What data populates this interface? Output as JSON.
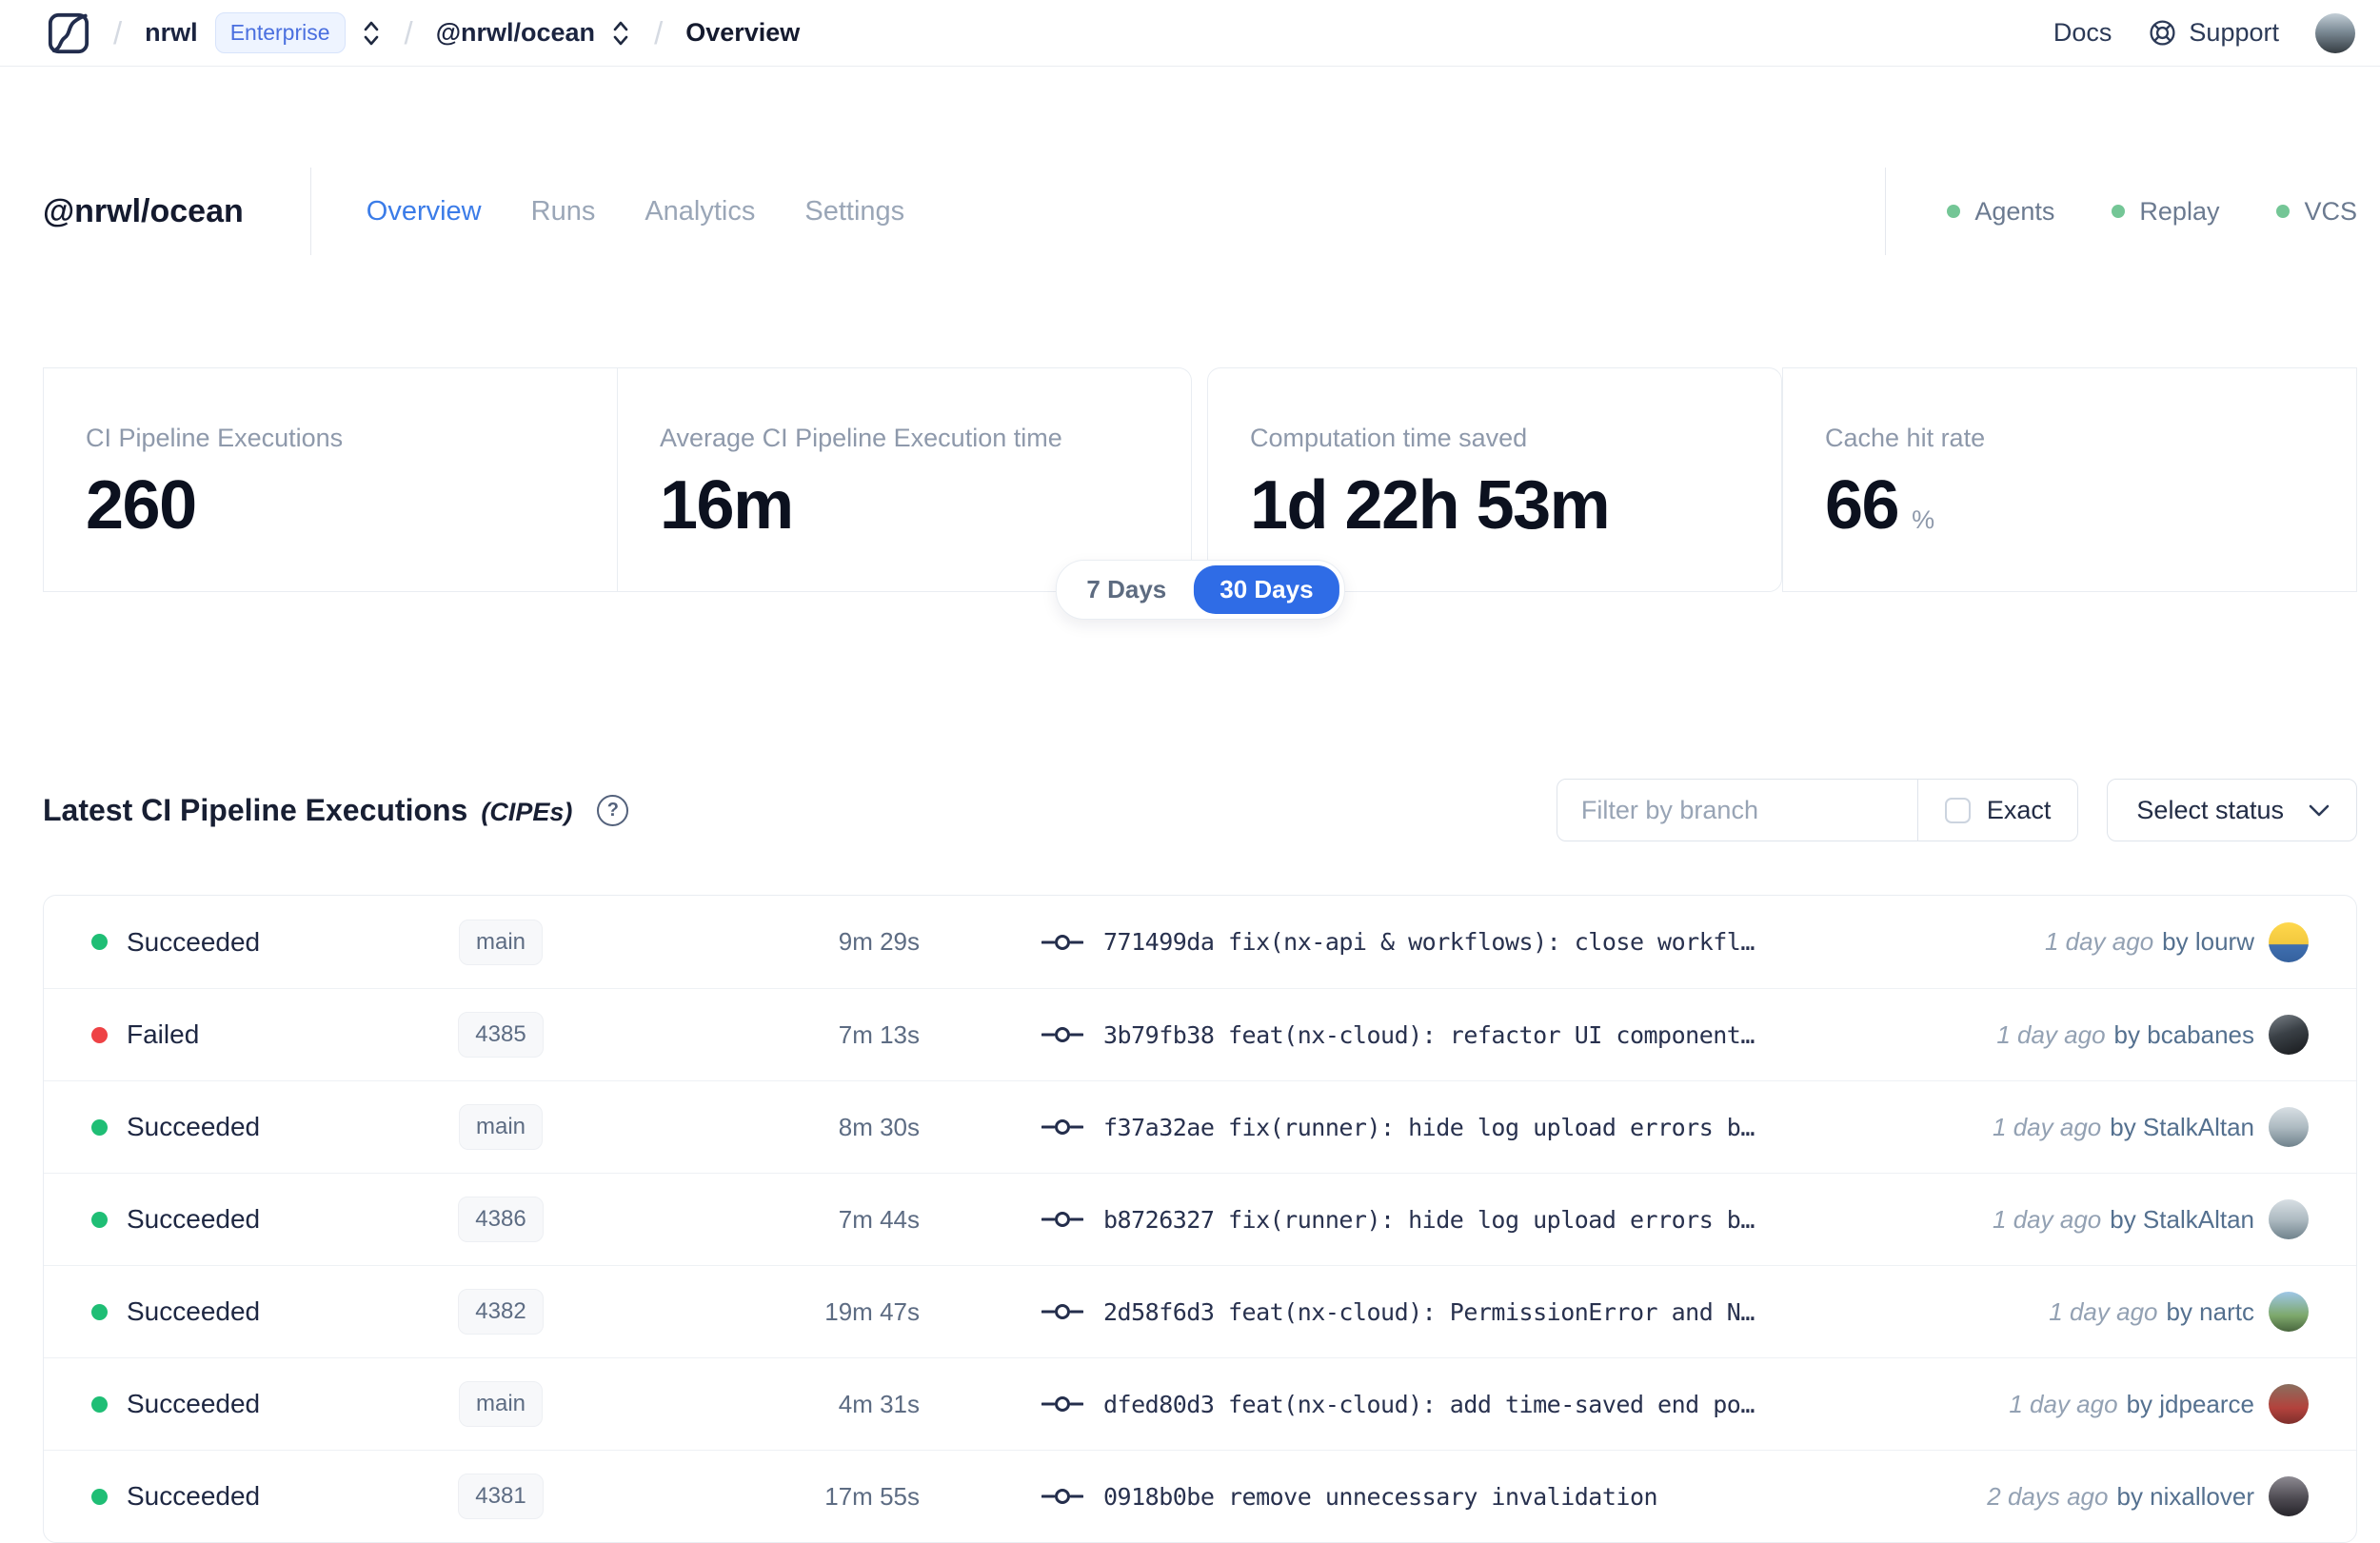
{
  "colors": {
    "accent_blue": "#2f6ce6",
    "tab_active_blue": "#3b7ce8",
    "success_green": "#1fbe75",
    "failed_red": "#ee4245",
    "service_status_green": "#74c696",
    "enterprise_badge_blue": "#4a6fdf"
  },
  "icons": {
    "breadcrumb_separator": "/",
    "help": "?"
  },
  "nav": {
    "org": "nrwl",
    "org_badge": "Enterprise",
    "workspace": "@nrwl/ocean",
    "page": "Overview",
    "docs_label": "Docs",
    "support_label": "Support"
  },
  "header": {
    "title": "@nrwl/ocean",
    "tabs": [
      {
        "label": "Overview",
        "class": "active"
      },
      {
        "label": "Runs"
      },
      {
        "label": "Analytics"
      },
      {
        "label": "Settings"
      }
    ],
    "services": [
      {
        "label": "Agents"
      },
      {
        "label": "Replay"
      },
      {
        "label": "VCS"
      }
    ]
  },
  "stats": {
    "cards": [
      {
        "label": "CI Pipeline Executions",
        "value": "260",
        "suffix": ""
      },
      {
        "label": "Average CI Pipeline Execution time",
        "value": "16m",
        "suffix": ""
      },
      {
        "label": "Computation time saved",
        "value": "1d 22h 53m",
        "suffix": ""
      },
      {
        "label": "Cache hit rate",
        "value": "66",
        "suffix": "%"
      }
    ],
    "range_toggle": {
      "selected": "30 Days",
      "options": [
        {
          "label": "7 Days"
        },
        {
          "label": "30 Days",
          "class": "active"
        }
      ]
    }
  },
  "executions": {
    "title": "Latest CI Pipeline Executions",
    "title_suffix": "(CIPEs)",
    "filter": {
      "branch_placeholder": "Filter by branch",
      "branch_value": "",
      "exact_label": "Exact",
      "exact_checked": false,
      "status_label": "Select status"
    },
    "rows": [
      {
        "state": "succeeded",
        "status": "Succeeded",
        "branch": "main",
        "duration": "9m 29s",
        "commit": "771499da fix(nx-api & workflows): close workfl…",
        "time_ago": "1 day ago",
        "author": "by lourw",
        "avatar": "av-lourw"
      },
      {
        "state": "failed",
        "status": "Failed",
        "branch": "4385",
        "duration": "7m 13s",
        "commit": "3b79fb38 feat(nx-cloud): refactor UI component…",
        "time_ago": "1 day ago",
        "author": "by bcabanes",
        "avatar": "av-bcabanes"
      },
      {
        "state": "succeeded",
        "status": "Succeeded",
        "branch": "main",
        "duration": "8m 30s",
        "commit": "f37a32ae fix(runner): hide log upload errors b…",
        "time_ago": "1 day ago",
        "author": "by StalkAltan",
        "avatar": "av-stalkaltan"
      },
      {
        "state": "succeeded",
        "status": "Succeeded",
        "branch": "4386",
        "duration": "7m 44s",
        "commit": "b8726327 fix(runner): hide log upload errors b…",
        "time_ago": "1 day ago",
        "author": "by StalkAltan",
        "avatar": "av-stalkaltan"
      },
      {
        "state": "succeeded",
        "status": "Succeeded",
        "branch": "4382",
        "duration": "19m 47s",
        "commit": "2d58f6d3 feat(nx-cloud): PermissionError and N…",
        "time_ago": "1 day ago",
        "author": "by nartc",
        "avatar": "av-nartc"
      },
      {
        "state": "succeeded",
        "status": "Succeeded",
        "branch": "main",
        "duration": "4m 31s",
        "commit": "dfed80d3 feat(nx-cloud): add time-saved end po…",
        "time_ago": "1 day ago",
        "author": "by jdpearce",
        "avatar": "av-jdpearce"
      },
      {
        "state": "succeeded",
        "status": "Succeeded",
        "branch": "4381",
        "duration": "17m 55s",
        "commit": "0918b0be remove unnecessary invalidation",
        "time_ago": "2 days ago",
        "author": "by nixallover",
        "avatar": "av-nixallover"
      }
    ]
  }
}
